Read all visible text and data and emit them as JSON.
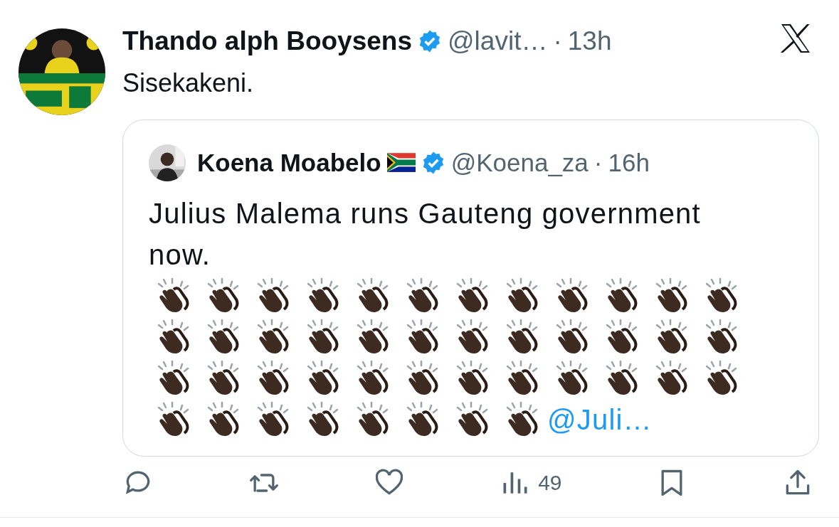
{
  "post": {
    "author": {
      "name": "Thando alph Booysens",
      "verified": true,
      "handle": "@lavit…",
      "separator": "·",
      "time": "13h"
    },
    "text": "Sisekakeni.",
    "quote": {
      "author": {
        "name": "Koena Moabelo",
        "verified": true,
        "handle": "@Koena_za",
        "separator": "·",
        "time": "16h"
      },
      "text": "Julius Malema runs Gauteng government now.",
      "emojis": [
        {
          "kind": "clap"
        },
        {
          "kind": "clap"
        },
        {
          "kind": "clap"
        },
        {
          "kind": "clap"
        },
        {
          "kind": "clap"
        },
        {
          "kind": "clap"
        },
        {
          "kind": "clap"
        },
        {
          "kind": "clap"
        },
        {
          "kind": "clap"
        },
        {
          "kind": "clap"
        },
        {
          "kind": "clap"
        },
        {
          "kind": "clap"
        },
        {
          "kind": "clap"
        },
        {
          "kind": "clap"
        },
        {
          "kind": "clap"
        },
        {
          "kind": "clap"
        },
        {
          "kind": "clap"
        },
        {
          "kind": "clap"
        },
        {
          "kind": "clap"
        },
        {
          "kind": "clap"
        },
        {
          "kind": "clap"
        },
        {
          "kind": "clap"
        },
        {
          "kind": "clap"
        },
        {
          "kind": "clap"
        },
        {
          "kind": "clap"
        },
        {
          "kind": "clap"
        },
        {
          "kind": "clap"
        },
        {
          "kind": "clap"
        },
        {
          "kind": "clap"
        },
        {
          "kind": "clap"
        },
        {
          "kind": "clap"
        },
        {
          "kind": "clap"
        },
        {
          "kind": "clap"
        },
        {
          "kind": "clap"
        },
        {
          "kind": "clap"
        },
        {
          "kind": "clap"
        },
        {
          "kind": "clap"
        },
        {
          "kind": "clap"
        },
        {
          "kind": "clap"
        },
        {
          "kind": "clap"
        },
        {
          "kind": "clap"
        },
        {
          "kind": "clap"
        },
        {
          "kind": "clap"
        },
        {
          "kind": "clap"
        }
      ],
      "mention": "@Juli…"
    },
    "actions": [
      {
        "kind": "reply"
      },
      {
        "kind": "repost"
      },
      {
        "kind": "like"
      },
      {
        "kind": "views",
        "count": "49"
      },
      {
        "kind": "bookmark"
      },
      {
        "kind": "share"
      }
    ]
  }
}
